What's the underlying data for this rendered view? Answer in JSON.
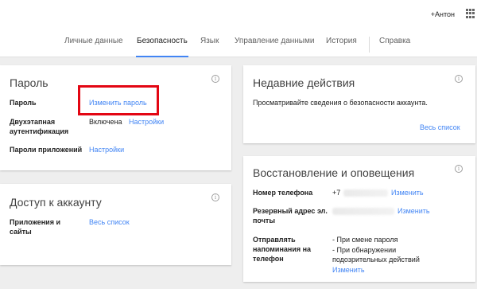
{
  "header": {
    "user": "+Антон",
    "apps_icon": "apps-grid-icon"
  },
  "tabs": [
    {
      "label": "Личные данные",
      "active": false
    },
    {
      "label": "Безопасность",
      "active": true
    },
    {
      "label": "Язык",
      "active": false
    },
    {
      "label": "Управление данными",
      "active": false
    },
    {
      "label": "История",
      "active": false
    },
    {
      "label": "Справка",
      "active": false
    }
  ],
  "password_card": {
    "title": "Пароль",
    "rows": {
      "password_label": "Пароль",
      "password_link": "Изменить пароль",
      "twofa_label": "Двухэтапная аутентификация",
      "twofa_value": "Включена",
      "twofa_link": "Настройки",
      "app_pw_label": "Пароли приложений",
      "app_pw_link": "Настройки"
    }
  },
  "access_card": {
    "title": "Доступ к аккаунту",
    "rows": {
      "apps_label": "Приложения и сайты",
      "apps_link": "Весь список"
    }
  },
  "recent_card": {
    "title": "Недавние действия",
    "description": "Просматривайте сведения о безопасности аккаунта.",
    "link": "Весь список"
  },
  "recovery_card": {
    "title": "Восстановление и оповещения",
    "rows": {
      "phone_label": "Номер телефона",
      "phone_value": "+7",
      "phone_link": "Изменить",
      "backup_label": "Резервный адрес эл. почты",
      "backup_link": "Изменить",
      "notify_label": "Отправлять напоминания на телефон",
      "notify_item1": "- При смене пароля",
      "notify_item2": "- При обнаружении подозрительных действий",
      "notify_link": "Изменить"
    }
  },
  "colors": {
    "accent": "#4285f4",
    "highlight": "#e30613",
    "background": "#eeeeee"
  }
}
